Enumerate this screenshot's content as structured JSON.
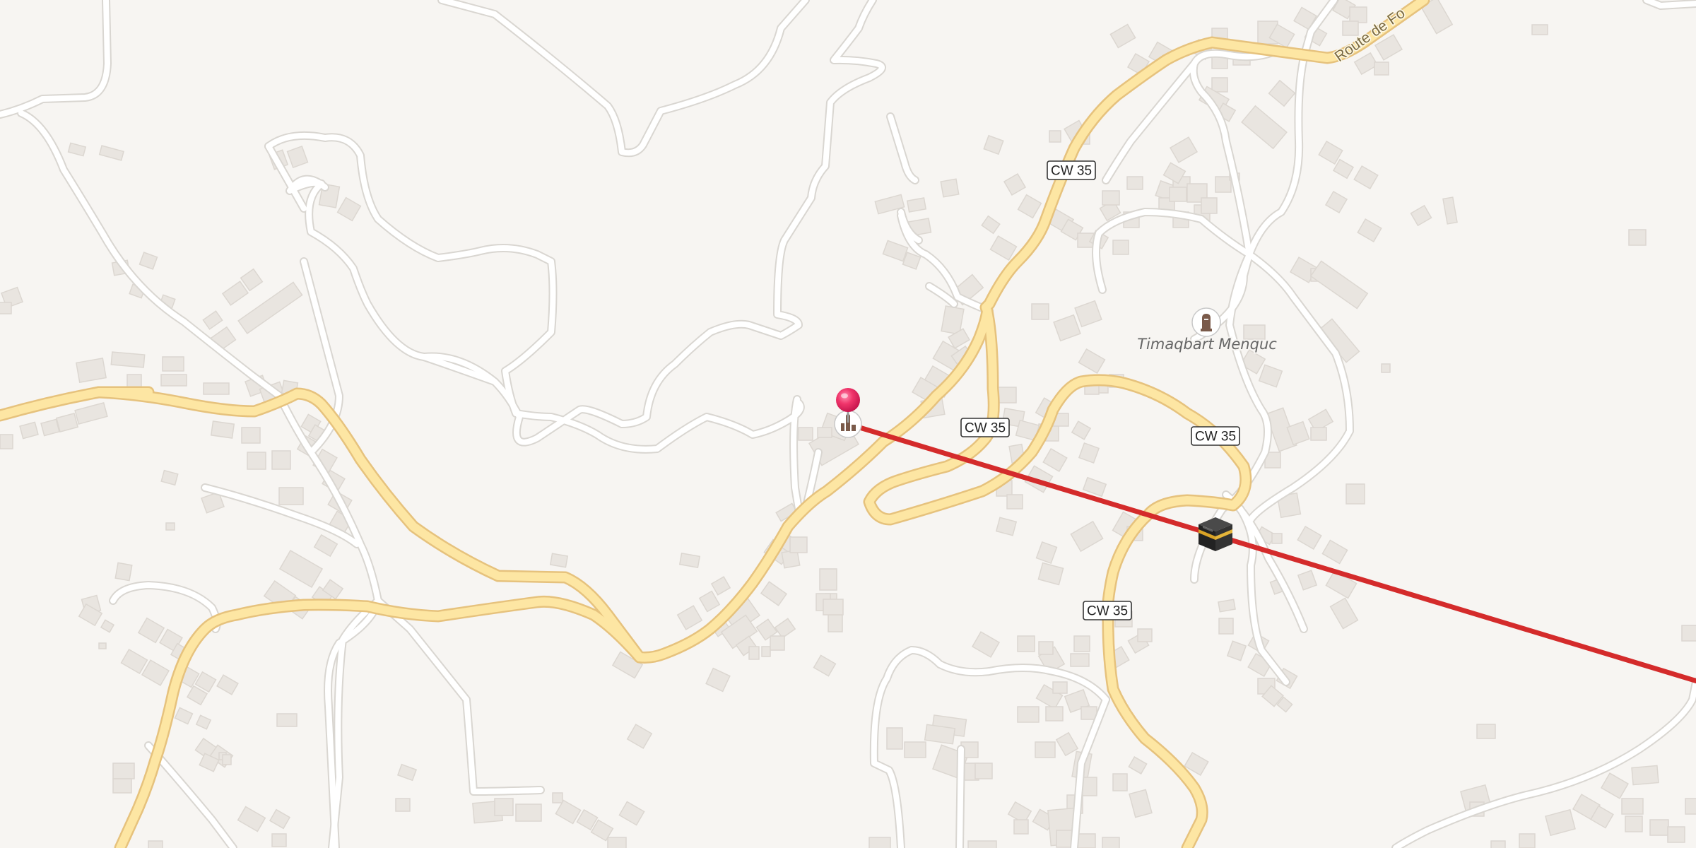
{
  "map": {
    "place_label": "Timaqbart Menquc",
    "street_label": "Route de Fo",
    "road_shields": [
      "CW 35",
      "CW 35",
      "CW 35",
      "CW 35"
    ],
    "icons": {
      "pin": "map-pin-icon",
      "origin_poi": "mosque-icon",
      "place_poi": "cemetery-icon",
      "destination": "kaaba-icon"
    },
    "colors": {
      "background": "#f7f5f2",
      "main_road": "#fde6a3",
      "main_road_casing": "#e6c27d",
      "minor_road": "#ffffff",
      "building": "#e9e5e0",
      "route_line": "#d42b2b",
      "pin": "#e8245c"
    }
  }
}
